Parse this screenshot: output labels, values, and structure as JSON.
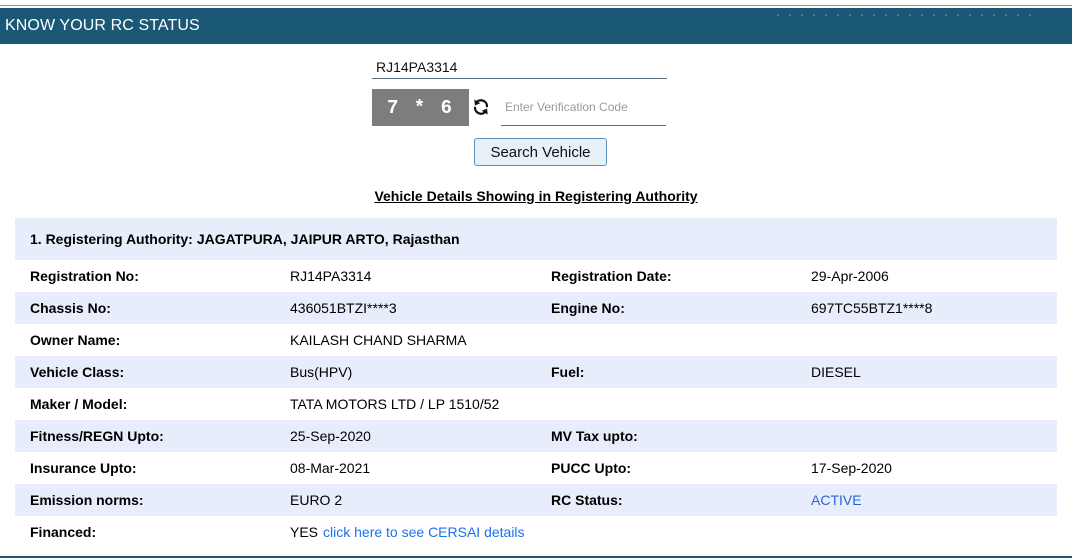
{
  "header": {
    "title": "KNOW YOUR RC STATUS"
  },
  "search": {
    "registration_value": "RJ14PA3314",
    "captcha_text": "7 * 6",
    "verification_placeholder": "Enter Verification Code",
    "verification_value": "",
    "button_label": "Search Vehicle",
    "refresh_icon": "refresh-icon"
  },
  "section_title": "Vehicle Details Showing in Registering Authority",
  "authority": {
    "label": "1. Registering Authority:",
    "value": "JAGATPURA, JAIPUR ARTO, Rajasthan"
  },
  "rows": [
    {
      "label1": "Registration No:",
      "value1": "RJ14PA3314",
      "label2": "Registration Date:",
      "value2": "29-Apr-2006"
    },
    {
      "label1": "Chassis No:",
      "value1": "436051BTZI****3",
      "label2": "Engine No:",
      "value2": "697TC55BTZ1****8"
    },
    {
      "label1": "Owner Name:",
      "value1": "KAILASH CHAND SHARMA",
      "label2": "",
      "value2": ""
    },
    {
      "label1": "Vehicle Class:",
      "value1": "Bus(HPV)",
      "label2": "Fuel:",
      "value2": "DIESEL"
    },
    {
      "label1": "Maker / Model:",
      "value1": "TATA MOTORS LTD / LP 1510/52",
      "label2": "",
      "value2": ""
    },
    {
      "label1": "Fitness/REGN Upto:",
      "value1": "25-Sep-2020",
      "label2": "MV Tax upto:",
      "value2": ""
    },
    {
      "label1": "Insurance Upto:",
      "value1": "08-Mar-2021",
      "label2": "PUCC Upto:",
      "value2": "17-Sep-2020"
    },
    {
      "label1": "Emission norms:",
      "value1": "EURO 2",
      "label2": "RC Status:",
      "value2": "ACTIVE"
    }
  ],
  "financed": {
    "label": "Financed:",
    "value": "YES",
    "link_text": "click here to see CERSAI details"
  },
  "colors": {
    "header_bg": "#1b5876",
    "row_shade": "#e8edfb",
    "status_active": "#2a63d4",
    "link": "#1a73e8"
  }
}
